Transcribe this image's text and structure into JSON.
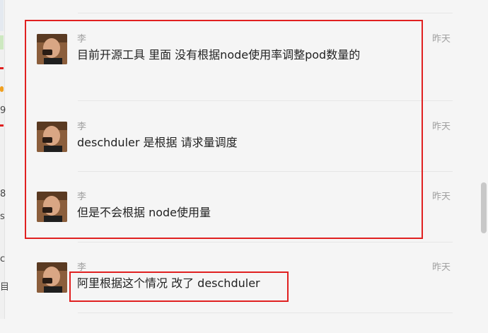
{
  "left_strip": {
    "glyphs": [
      "9",
      "8",
      "s",
      "c",
      "目"
    ]
  },
  "colors": {
    "highlight": "#e02020",
    "avatar": "#8b5e3c",
    "meta_text": "#a0a0a0",
    "background": "#f5f5f5"
  },
  "messages": [
    {
      "sender": "李",
      "time": "昨天",
      "text": "目前开源工具 里面 没有根据node使用率调整pod数量的"
    },
    {
      "sender": "李",
      "time": "昨天",
      "text": "deschduler 是根据 请求量调度"
    },
    {
      "sender": "李",
      "time": "昨天",
      "text": "但是不会根据 node使用量"
    },
    {
      "sender": "李",
      "time": "昨天",
      "text": "阿里根据这个情况 改了 deschduler"
    }
  ]
}
